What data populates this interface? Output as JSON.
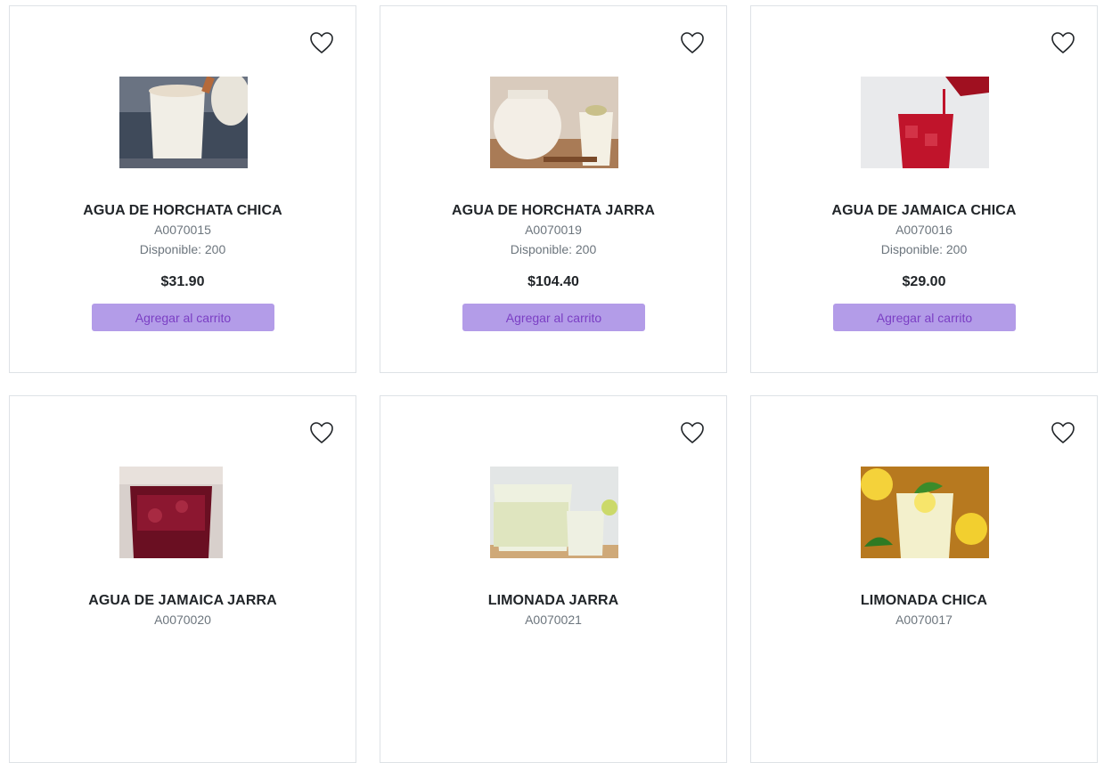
{
  "products": [
    {
      "name": "AGUA DE HORCHATA CHICA",
      "code": "A0070015",
      "stock": "Disponible: 200",
      "price": "$31.90",
      "button": "Agregar al carrito",
      "image": "horchata-glass-photo",
      "favorite_icon": "heart-outline-icon"
    },
    {
      "name": "AGUA DE HORCHATA JARRA",
      "code": "A0070019",
      "stock": "Disponible: 200",
      "price": "$104.40",
      "button": "Agregar al carrito",
      "image": "horchata-pitcher-photo",
      "favorite_icon": "heart-outline-icon"
    },
    {
      "name": "AGUA DE JAMAICA CHICA",
      "code": "A0070016",
      "stock": "Disponible: 200",
      "price": "$29.00",
      "button": "Agregar al carrito",
      "image": "jamaica-glass-photo",
      "favorite_icon": "heart-outline-icon"
    },
    {
      "name": "AGUA DE JAMAICA JARRA",
      "code": "A0070020",
      "image": "jamaica-pitcher-photo",
      "favorite_icon": "heart-outline-icon"
    },
    {
      "name": "LIMONADA JARRA",
      "code": "A0070021",
      "image": "lemonade-pitcher-photo",
      "favorite_icon": "heart-outline-icon"
    },
    {
      "name": "LIMONADA CHICA",
      "code": "A0070017",
      "image": "lemonade-glass-photo",
      "favorite_icon": "heart-outline-icon"
    }
  ],
  "colors": {
    "button_bg": "#b39ce8",
    "button_text": "#7b3fc4",
    "border": "#dee2e6",
    "muted_text": "#6c757d"
  }
}
